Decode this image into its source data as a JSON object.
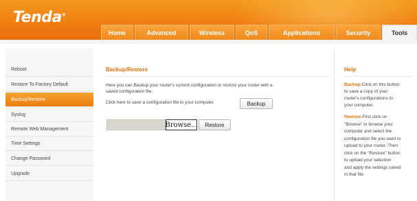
{
  "header": {
    "logo": "Tenda",
    "logo_mark": "®",
    "tabs": [
      {
        "label": "Home",
        "active": false
      },
      {
        "label": "Advanced",
        "active": false
      },
      {
        "label": "Wireless",
        "active": false
      },
      {
        "label": "QoS",
        "active": false
      },
      {
        "label": "Applications",
        "active": false
      },
      {
        "label": "Security",
        "active": false
      },
      {
        "label": "Tools",
        "active": true
      }
    ]
  },
  "sidebar": {
    "items": [
      {
        "label": "Reboot",
        "active": false
      },
      {
        "label": "Restore To Factory Default",
        "active": false
      },
      {
        "label": "Backup/Restore",
        "active": true
      },
      {
        "label": "Syslog",
        "active": false
      },
      {
        "label": "Remote Web Management",
        "active": false
      },
      {
        "label": "Time Settings",
        "active": false
      },
      {
        "label": "Change Password",
        "active": false
      },
      {
        "label": "Upgrade",
        "active": false
      }
    ]
  },
  "main": {
    "title": "Backup/Restore",
    "desc_line1": "Here you can Backup your router's current configuration or restore your router with a",
    "desc_line2": "saved configuration file.",
    "save_prompt": "Click here to save a configuration file to your computer",
    "backup_label": "Backup",
    "file_value": "",
    "browse_label": "Browse...",
    "restore_label": "Restore"
  },
  "help": {
    "title": "Help",
    "backup_keyword": "Backup:",
    "backup_lines": [
      "Click on this button",
      "to save a copy of your",
      "router's configurations to",
      "your computer."
    ],
    "restore_keyword": "Restore:",
    "restore_lines": [
      "First click on",
      "\"Browse\" to browse your",
      "computer and select the",
      "configuration file you want to",
      "upload to your router. Then",
      "click on the \"Restore\" button",
      "to  upload your selection",
      "and apply the settings saved",
      "in that file."
    ]
  },
  "colors": {
    "accent": "#e8710a",
    "header_orange": "#f07f12",
    "sidebar_bg": "#f6f6f6"
  }
}
